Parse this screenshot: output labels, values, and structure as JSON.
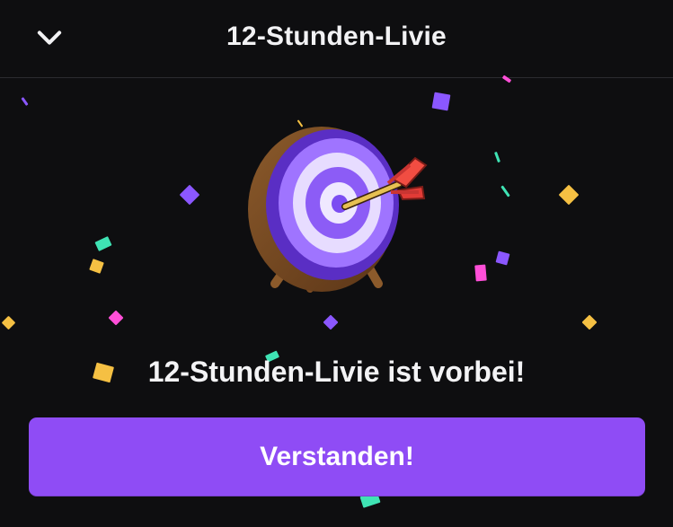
{
  "header": {
    "title": "12-Stunden-Livie",
    "back_icon": "chevron-down-icon"
  },
  "illustration": {
    "icon": "target-with-arrow-icon"
  },
  "main": {
    "message": "12-Stunden-Livie ist vorbei!",
    "button_label": "Verstanden!"
  },
  "theme": {
    "background": "#0e0e10",
    "accent": "#8f4cf5",
    "text": "#efeff1",
    "confetti_colors": [
      "#8b57ff",
      "#ff4fd8",
      "#f5c043",
      "#3fe3b4"
    ]
  }
}
